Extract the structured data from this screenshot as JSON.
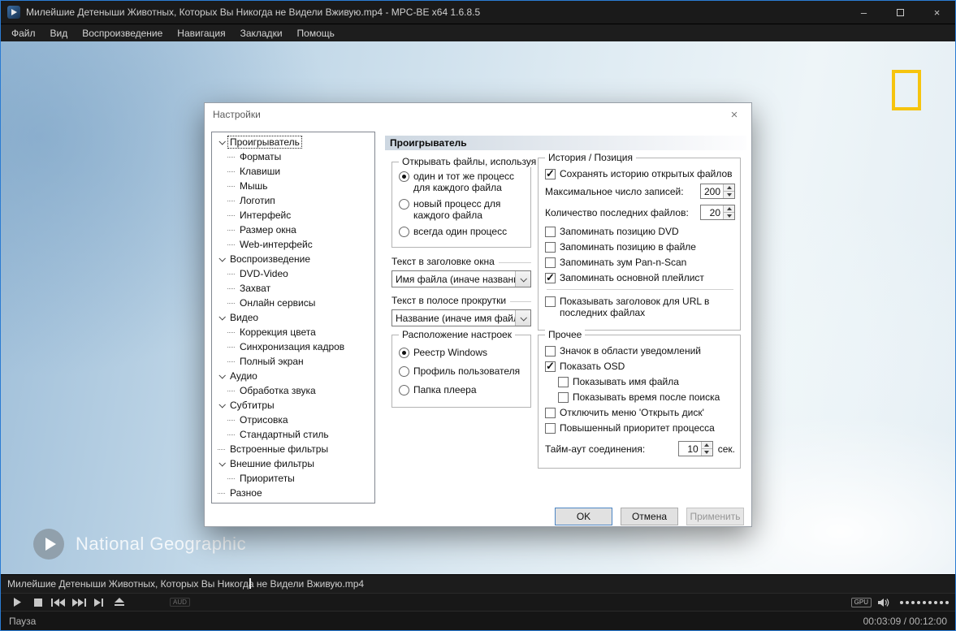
{
  "window": {
    "title": "Милейшие Детеныши Животных, Которых Вы Никогда не Видели Вживую.mp4 - MPC-BE x64 1.6.8.5",
    "minimize": "–",
    "close": "×"
  },
  "menu": {
    "items": [
      "Файл",
      "Вид",
      "Воспроизведение",
      "Навигация",
      "Закладки",
      "Помощь"
    ]
  },
  "video": {
    "watermark_text": "National Geographic"
  },
  "dialog": {
    "title": "Настройки",
    "close": "×",
    "page_title": "Проигрыватель",
    "tree": [
      {
        "label": "Проигрыватель"
      },
      {
        "label": "Форматы"
      },
      {
        "label": "Клавиши"
      },
      {
        "label": "Мышь"
      },
      {
        "label": "Логотип"
      },
      {
        "label": "Интерфейс"
      },
      {
        "label": "Размер окна"
      },
      {
        "label": "Web-интерфейс"
      },
      {
        "label": "Воспроизведение"
      },
      {
        "label": "DVD-Video"
      },
      {
        "label": "Захват"
      },
      {
        "label": "Онлайн сервисы"
      },
      {
        "label": "Видео"
      },
      {
        "label": "Коррекция цвета"
      },
      {
        "label": "Синхронизация кадров"
      },
      {
        "label": "Полный экран"
      },
      {
        "label": "Аудио"
      },
      {
        "label": "Обработка звука"
      },
      {
        "label": "Субтитры"
      },
      {
        "label": "Отрисовка"
      },
      {
        "label": "Стандартный стиль"
      },
      {
        "label": "Встроенные фильтры"
      },
      {
        "label": "Внешние фильтры"
      },
      {
        "label": "Приоритеты"
      },
      {
        "label": "Разное"
      }
    ],
    "open_files": {
      "label": "Открывать файлы, используя",
      "opt1": "один и тот же процесс для каждого файла",
      "opt2": "новый процесс для каждого файла",
      "opt3": "всегда один процесс"
    },
    "title_bar_text": {
      "label": "Текст в заголовке окна",
      "value": "Имя файла (иначе название"
    },
    "seekbar_text": {
      "label": "Текст в полосе прокрутки",
      "value": "Название (иначе имя файла"
    },
    "settings_location": {
      "label": "Расположение настроек",
      "opt1": "Реестр Windows",
      "opt2": "Профиль пользователя",
      "opt3": "Папка плеера"
    },
    "history": {
      "label": "История / Позиция",
      "save_history": "Сохранять историю открытых файлов",
      "max_records_label": "Максимальное число записей:",
      "max_records_value": "200",
      "recent_files_label": "Количество последних файлов:",
      "recent_files_value": "20",
      "remember_dvd": "Запоминать позицию DVD",
      "remember_file": "Запоминать позицию в файле",
      "remember_zoom": "Запоминать зум Pan-n-Scan",
      "remember_playlist": "Запоминать основной плейлист",
      "show_url_title": "Показывать заголовок для URL в последних файлах"
    },
    "misc": {
      "label": "Прочее",
      "tray_icon": "Значок в области уведомлений",
      "show_osd": "Показать OSD",
      "show_filename": "Показывать имя файла",
      "show_seek_time": "Показывать время после поиска",
      "disable_open_disc": "Отключить меню 'Открыть диск'",
      "high_priority": "Повышенный приоритет процесса",
      "timeout_label": "Тайм-аут соединения:",
      "timeout_value": "10",
      "timeout_suffix": "сек."
    },
    "buttons": {
      "ok": "OK",
      "cancel": "Отмена",
      "apply": "Применить"
    }
  },
  "player": {
    "seek_filename": "Милейшие Детеныши Животных, Которых Вы Никогда не Видели Вживую.mp4",
    "aud_badge": "AUD",
    "gpu_badge": "GPU",
    "status": "Пауза",
    "time": "00:03:09 / 00:12:00"
  }
}
